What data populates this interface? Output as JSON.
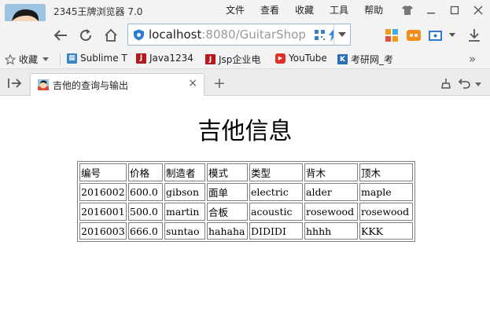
{
  "window": {
    "app_title": "2345王牌浏览器 7.0",
    "menu": [
      "文件",
      "查看",
      "收藏",
      "工具",
      "帮助"
    ]
  },
  "nav": {
    "url_host": "localhost",
    "url_rest": ":8080/GuitarShop"
  },
  "bookmarks": {
    "favorites_label": "收藏",
    "items": [
      {
        "label": "Sublime T",
        "icon": "sublime-icon",
        "color": "#3b86c6"
      },
      {
        "label": "Java1234",
        "icon": "java1234-icon",
        "color": "#b3181c"
      },
      {
        "label": "Jsp企业电",
        "icon": "jsp-icon",
        "color": "#b3181c"
      },
      {
        "label": "YouTube",
        "icon": "youtube-icon",
        "color": "#e52d27"
      },
      {
        "label": "考研网_考",
        "icon": "kaoyan-icon",
        "color": "#2a6fb5"
      }
    ]
  },
  "tab": {
    "title": "吉他的查询与输出"
  },
  "page": {
    "title": "吉他信息",
    "table": {
      "headers": [
        "编号",
        "价格",
        "制造者",
        "模式",
        "类型",
        "背木",
        "顶木"
      ],
      "rows": [
        [
          "2016002",
          "600.0",
          "gibson",
          "面单",
          "electric",
          "alder",
          "maple"
        ],
        [
          "2016001",
          "500.0",
          "martin",
          "合板",
          "acoustic",
          "rosewood",
          "rosewood"
        ],
        [
          "2016003",
          "666.0",
          "suntao",
          "hahaha",
          "DIDIDI",
          "hhhh",
          "KKK"
        ]
      ]
    }
  }
}
